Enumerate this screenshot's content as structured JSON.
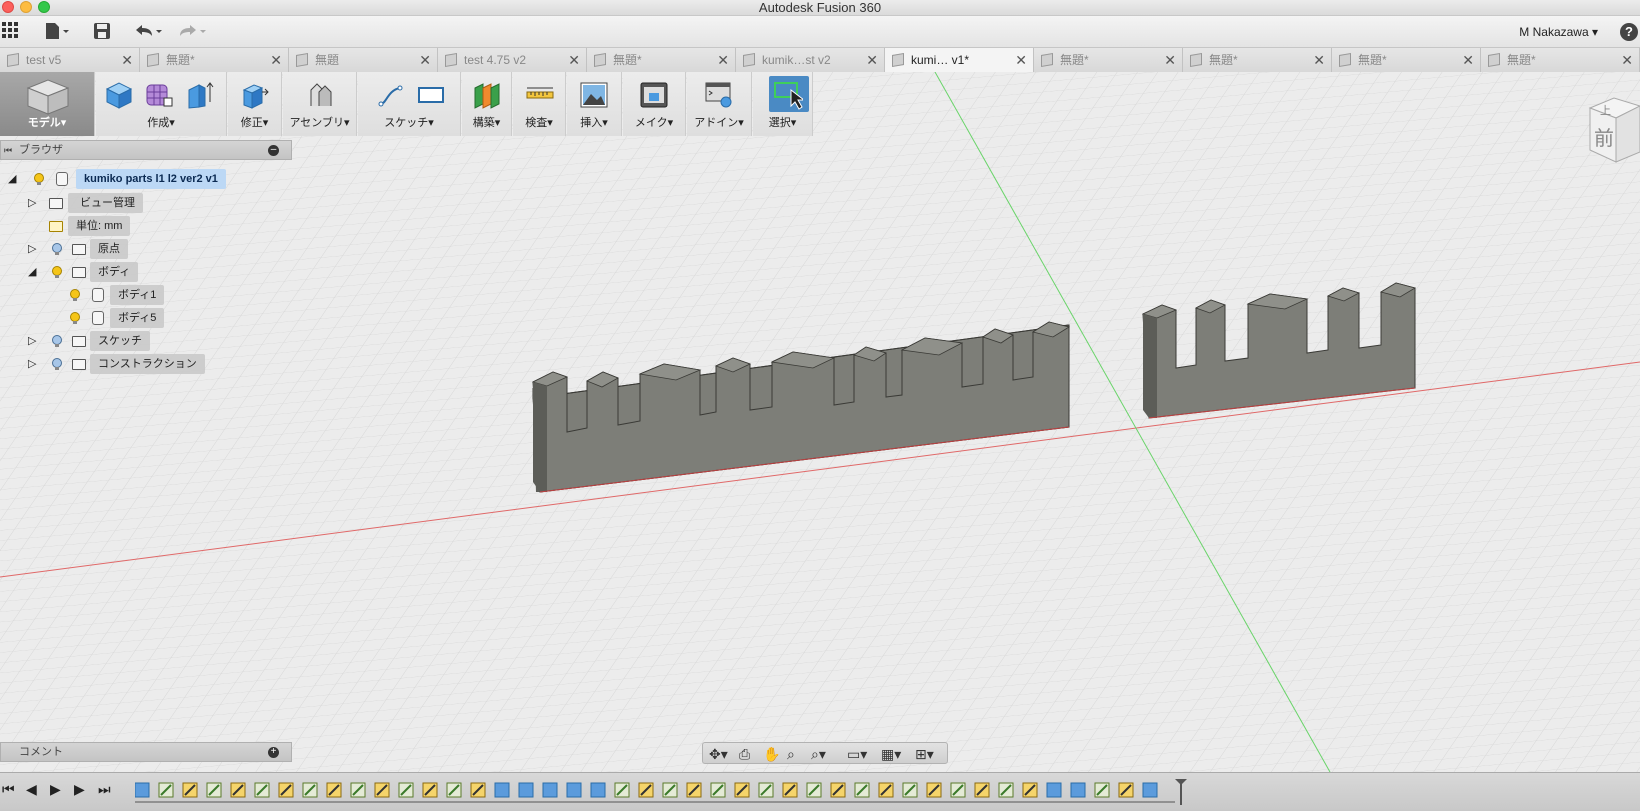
{
  "window": {
    "title": "Autodesk Fusion 360"
  },
  "qat": {
    "user": "M Nakazawa",
    "help": "?"
  },
  "tabs": [
    {
      "label": "test v5",
      "active": false
    },
    {
      "label": "無題*",
      "active": false
    },
    {
      "label": "無題",
      "active": false
    },
    {
      "label": "test 4.75 v2",
      "active": false
    },
    {
      "label": "無題*",
      "active": false
    },
    {
      "label": "kumik…st v2",
      "active": false
    },
    {
      "label": "kumi… v1*",
      "active": true
    },
    {
      "label": "無題*",
      "active": false
    },
    {
      "label": "無題*",
      "active": false
    },
    {
      "label": "無題*",
      "active": false
    },
    {
      "label": "無題*",
      "active": false
    }
  ],
  "ribbon": {
    "workspace": "モデル",
    "groups": [
      {
        "label": "作成"
      },
      {
        "label": "修正"
      },
      {
        "label": "アセンブリ"
      },
      {
        "label": "スケッチ"
      },
      {
        "label": "構築"
      },
      {
        "label": "検査"
      },
      {
        "label": "挿入"
      },
      {
        "label": "メイク"
      },
      {
        "label": "アドイン"
      },
      {
        "label": "選択"
      }
    ]
  },
  "browser": {
    "header": "ブラウザ",
    "root": "kumiko parts l1 l2 ver2 v1",
    "items": [
      {
        "label": "ビュー管理"
      },
      {
        "label": "単位: mm"
      },
      {
        "label": "原点"
      },
      {
        "label": "ボディ"
      },
      {
        "label": "ボディ1"
      },
      {
        "label": "ボディ5"
      },
      {
        "label": "スケッチ"
      },
      {
        "label": "コンストラクション"
      }
    ]
  },
  "comments": {
    "label": "コメント"
  },
  "viewcube": {
    "face": "前",
    "top": "上"
  },
  "colors": {
    "accent": "#4a90d9",
    "body": "#7a7b75",
    "x_axis": "#e05050",
    "y_axis": "#40c040"
  }
}
